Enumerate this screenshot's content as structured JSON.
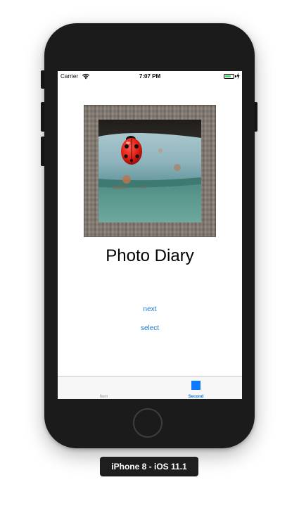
{
  "status_bar": {
    "carrier": "Carrier",
    "time": "7:07 PM",
    "wifi_icon": "wifi-icon",
    "battery_icon": "battery-icon",
    "battery_level": 0.7,
    "charging_icon": "charging-bolt-icon",
    "battery_color": "#4cd964"
  },
  "main": {
    "image_icon": "ladybug-photo",
    "title": "Photo Diary",
    "next_label": "next",
    "select_label": "select",
    "link_color": "#1a76d2"
  },
  "tab_bar": {
    "items": [
      {
        "label": "Item",
        "selected": false
      },
      {
        "label": "Second",
        "selected": true,
        "icon": "square-icon",
        "icon_color": "#0a7aff"
      }
    ]
  },
  "device": {
    "label": "iPhone 8 - iOS 11.1"
  }
}
